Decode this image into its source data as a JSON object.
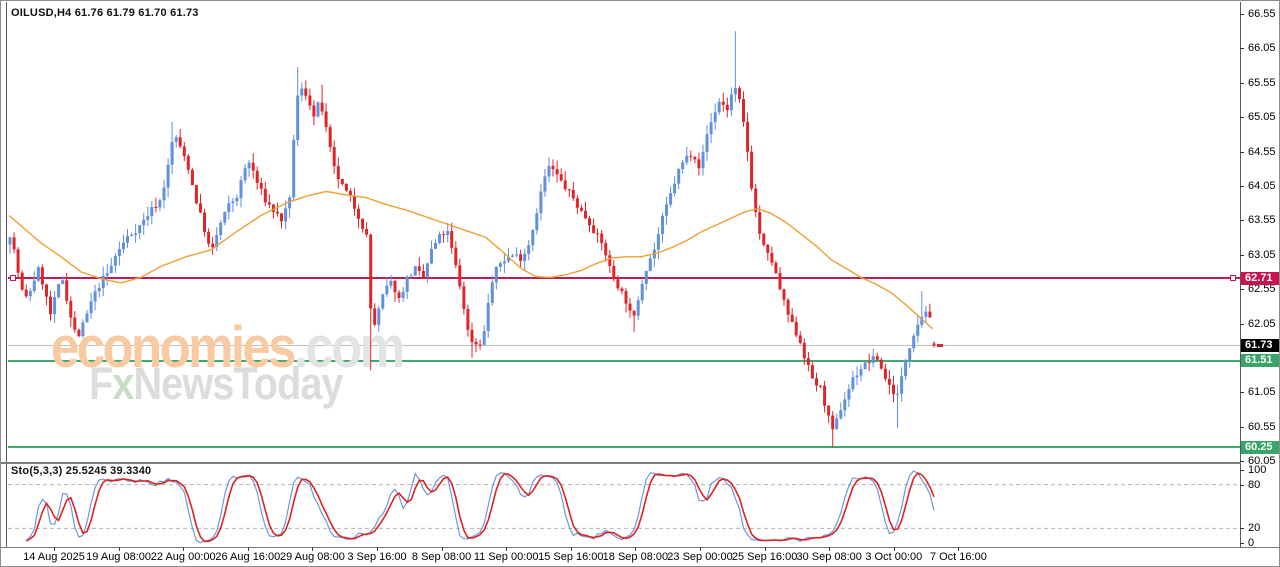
{
  "header": {
    "symbol_line": "OILUSD,H4  61.76 61.79 61.70 61.73"
  },
  "indicator": {
    "label": "Sto(5,3,3) 25.5245 39.3340",
    "last_main": 25.5245,
    "last_signal": 39.334
  },
  "watermark": {
    "brand": "economies",
    "domain": ".com",
    "sub_f": "F",
    "sub_x": "x",
    "sub_rest": "NewsToday",
    "brand_color": "#f8caa2",
    "domain_color": "#e3e3e3",
    "sub_color": "#dcdcdc",
    "sub_x_color": "#c8ddc6"
  },
  "colors": {
    "up_candle": "#6090e0",
    "down_candle": "#e02528",
    "ma_line": "#ef9f33",
    "sto_main": "#6f96d9",
    "sto_signal": "#dd2222",
    "sto_level_dash": "#b5b5b5",
    "axis_text": "#000000",
    "frame": "#5a5a5a"
  },
  "price_axis": {
    "labels": [
      "66.55",
      "66.05",
      "65.55",
      "65.05",
      "64.55",
      "64.05",
      "63.55",
      "63.05",
      "62.55",
      "62.05",
      "61.05",
      "60.55",
      "60.05"
    ],
    "indicator_labels": [
      {
        "text": "100",
        "v": 100
      },
      {
        "text": "80",
        "v": 80
      },
      {
        "text": "20",
        "v": 20
      },
      {
        "text": "0",
        "v": 0
      }
    ]
  },
  "time_axis": {
    "start_center_x": 53,
    "spacing": 64.6,
    "labels": [
      "14 Aug 2025",
      "19 Aug 08:00",
      "22 Aug 00:00",
      "26 Aug 16:00",
      "29 Aug 08:00",
      "3 Sep 16:00",
      "8 Sep 08:00",
      "11 Sep 00:00",
      "15 Sep 16:00",
      "18 Sep 08:00",
      "23 Sep 00:00",
      "25 Sep 16:00",
      "30 Sep 08:00",
      "3 Oct 00:00",
      "7 Oct 16:00"
    ]
  },
  "chart_data": {
    "type": "candlestick",
    "symbol": "OILUSD",
    "timeframe": "H4",
    "last_ohlc": {
      "open": 61.76,
      "high": 61.79,
      "low": 61.7,
      "close": 61.73
    },
    "y_range": {
      "top_price": 66.55,
      "bottom_price": 60.05
    },
    "levels": [
      {
        "value": 62.71,
        "label": "62.71",
        "line_color": "#c41a53",
        "badge_bg": "#c9134e",
        "thickness": 2,
        "handles": true
      },
      {
        "value": 61.73,
        "label": "61.73",
        "line_color": "#bdbdbd",
        "badge_bg": "#000000",
        "thickness": 1,
        "handles": false
      },
      {
        "value": 61.51,
        "label": "61.51",
        "line_color": "#3faa6e",
        "badge_bg": "#38a468",
        "thickness": 2,
        "handles": false
      },
      {
        "value": 60.25,
        "label": "60.25",
        "line_color": "#3faa6e",
        "badge_bg": "#38a468",
        "thickness": 2,
        "handles": false
      }
    ],
    "candles": {
      "count": 229,
      "first_x": 9,
      "spacing": 4.0526,
      "body_width": 3,
      "first_open": 63.2,
      "noise_close": 0.1,
      "noise_wick": 0.14,
      "seed": 7
    },
    "close_path": [
      [
        9,
        63.35
      ],
      [
        14,
        63.05
      ],
      [
        20,
        62.55
      ],
      [
        26,
        62.4
      ],
      [
        32,
        62.65
      ],
      [
        38,
        62.85
      ],
      [
        44,
        62.5
      ],
      [
        50,
        62.15
      ],
      [
        56,
        62.55
      ],
      [
        62,
        62.7
      ],
      [
        68,
        62.25
      ],
      [
        73,
        61.95
      ],
      [
        78,
        61.88
      ],
      [
        84,
        62.1
      ],
      [
        90,
        62.35
      ],
      [
        96,
        62.55
      ],
      [
        102,
        62.7
      ],
      [
        108,
        62.8
      ],
      [
        115,
        63.05
      ],
      [
        126,
        63.3
      ],
      [
        138,
        63.45
      ],
      [
        150,
        63.7
      ],
      [
        160,
        63.85
      ],
      [
        168,
        64.4
      ],
      [
        173,
        64.85
      ],
      [
        179,
        64.6
      ],
      [
        186,
        64.4
      ],
      [
        194,
        63.9
      ],
      [
        202,
        63.5
      ],
      [
        210,
        63.05
      ],
      [
        218,
        63.45
      ],
      [
        227,
        63.75
      ],
      [
        236,
        63.9
      ],
      [
        244,
        64.3
      ],
      [
        249,
        64.4
      ],
      [
        256,
        64.1
      ],
      [
        264,
        63.85
      ],
      [
        272,
        63.7
      ],
      [
        281,
        63.55
      ],
      [
        289,
        63.85
      ],
      [
        295,
        65.3
      ],
      [
        301,
        65.45
      ],
      [
        307,
        65.35
      ],
      [
        313,
        65.05
      ],
      [
        319,
        65.3
      ],
      [
        326,
        64.8
      ],
      [
        333,
        64.3
      ],
      [
        341,
        64.05
      ],
      [
        350,
        63.85
      ],
      [
        358,
        63.6
      ],
      [
        366,
        63.3
      ],
      [
        371,
        61.9
      ],
      [
        377,
        62.2
      ],
      [
        384,
        62.55
      ],
      [
        391,
        62.65
      ],
      [
        398,
        62.4
      ],
      [
        406,
        62.7
      ],
      [
        414,
        62.85
      ],
      [
        422,
        62.7
      ],
      [
        430,
        63.1
      ],
      [
        438,
        63.3
      ],
      [
        446,
        63.4
      ],
      [
        453,
        63.0
      ],
      [
        461,
        62.45
      ],
      [
        468,
        61.85
      ],
      [
        475,
        61.75
      ],
      [
        482,
        61.8
      ],
      [
        489,
        62.55
      ],
      [
        497,
        62.9
      ],
      [
        505,
        63.0
      ],
      [
        513,
        63.05
      ],
      [
        521,
        63.0
      ],
      [
        529,
        63.25
      ],
      [
        536,
        63.7
      ],
      [
        543,
        64.15
      ],
      [
        549,
        64.35
      ],
      [
        556,
        64.2
      ],
      [
        563,
        64.05
      ],
      [
        571,
        63.9
      ],
      [
        579,
        63.7
      ],
      [
        587,
        63.55
      ],
      [
        595,
        63.35
      ],
      [
        603,
        63.15
      ],
      [
        611,
        62.75
      ],
      [
        619,
        62.55
      ],
      [
        626,
        62.35
      ],
      [
        632,
        62.05
      ],
      [
        639,
        62.55
      ],
      [
        646,
        62.9
      ],
      [
        654,
        63.15
      ],
      [
        661,
        63.55
      ],
      [
        669,
        63.9
      ],
      [
        677,
        64.25
      ],
      [
        684,
        64.45
      ],
      [
        692,
        64.55
      ],
      [
        699,
        64.3
      ],
      [
        706,
        64.8
      ],
      [
        713,
        65.1
      ],
      [
        719,
        65.3
      ],
      [
        726,
        65.15
      ],
      [
        733,
        65.5
      ],
      [
        739,
        65.25
      ],
      [
        745,
        64.75
      ],
      [
        751,
        64.0
      ],
      [
        757,
        63.45
      ],
      [
        764,
        63.1
      ],
      [
        771,
        62.95
      ],
      [
        778,
        62.6
      ],
      [
        785,
        62.25
      ],
      [
        792,
        62.0
      ],
      [
        799,
        61.8
      ],
      [
        806,
        61.45
      ],
      [
        813,
        61.2
      ],
      [
        820,
        61.1
      ],
      [
        827,
        60.7
      ],
      [
        832,
        60.45
      ],
      [
        838,
        60.75
      ],
      [
        845,
        61.0
      ],
      [
        852,
        61.25
      ],
      [
        860,
        61.4
      ],
      [
        868,
        61.5
      ],
      [
        876,
        61.55
      ],
      [
        883,
        61.3
      ],
      [
        890,
        61.1
      ],
      [
        897,
        61.0
      ],
      [
        904,
        61.5
      ],
      [
        911,
        61.85
      ],
      [
        918,
        62.1
      ],
      [
        925,
        62.25
      ],
      [
        930,
        62.05
      ],
      [
        933,
        61.73
      ]
    ],
    "wick_overrides": {
      "40": {
        "high": 64.98
      },
      "71": {
        "high": 65.78
      },
      "77": {
        "high": 65.52
      },
      "89": {
        "low": 61.37
      },
      "114": {
        "low": 61.55
      },
      "133": {
        "high": 64.47
      },
      "154": {
        "low": 61.93
      },
      "179": {
        "high": 66.3
      },
      "203": {
        "low": 60.25
      },
      "219": {
        "low": 60.53
      },
      "225": {
        "high": 62.52
      },
      "228": {
        "open": 61.76,
        "high": 61.79,
        "low": 61.7,
        "close": 61.73
      }
    },
    "ma_path": [
      [
        8,
        63.62
      ],
      [
        40,
        63.22
      ],
      [
        60,
        63.02
      ],
      [
        80,
        62.8
      ],
      [
        100,
        62.7
      ],
      [
        120,
        62.64
      ],
      [
        140,
        62.72
      ],
      [
        160,
        62.88
      ],
      [
        185,
        63.02
      ],
      [
        210,
        63.12
      ],
      [
        235,
        63.38
      ],
      [
        260,
        63.62
      ],
      [
        285,
        63.8
      ],
      [
        305,
        63.9
      ],
      [
        325,
        63.97
      ],
      [
        345,
        63.92
      ],
      [
        365,
        63.88
      ],
      [
        385,
        63.78
      ],
      [
        405,
        63.7
      ],
      [
        425,
        63.6
      ],
      [
        445,
        63.5
      ],
      [
        465,
        63.4
      ],
      [
        485,
        63.3
      ],
      [
        505,
        63.05
      ],
      [
        520,
        62.85
      ],
      [
        535,
        62.73
      ],
      [
        550,
        62.72
      ],
      [
        565,
        62.76
      ],
      [
        580,
        62.82
      ],
      [
        595,
        62.92
      ],
      [
        610,
        63.0
      ],
      [
        625,
        63.02
      ],
      [
        640,
        63.02
      ],
      [
        655,
        63.07
      ],
      [
        670,
        63.15
      ],
      [
        685,
        63.25
      ],
      [
        700,
        63.38
      ],
      [
        715,
        63.48
      ],
      [
        730,
        63.58
      ],
      [
        745,
        63.68
      ],
      [
        757,
        63.72
      ],
      [
        770,
        63.65
      ],
      [
        785,
        63.52
      ],
      [
        800,
        63.35
      ],
      [
        815,
        63.18
      ],
      [
        830,
        62.98
      ],
      [
        845,
        62.85
      ],
      [
        860,
        62.72
      ],
      [
        875,
        62.62
      ],
      [
        890,
        62.5
      ],
      [
        905,
        62.32
      ],
      [
        918,
        62.15
      ],
      [
        928,
        62.02
      ],
      [
        933,
        61.96
      ]
    ],
    "stochastic": {
      "k_period": 5,
      "slowing": 3,
      "d_period": 3,
      "scale_levels": [
        80,
        20
      ],
      "range": [
        0,
        100
      ]
    }
  }
}
